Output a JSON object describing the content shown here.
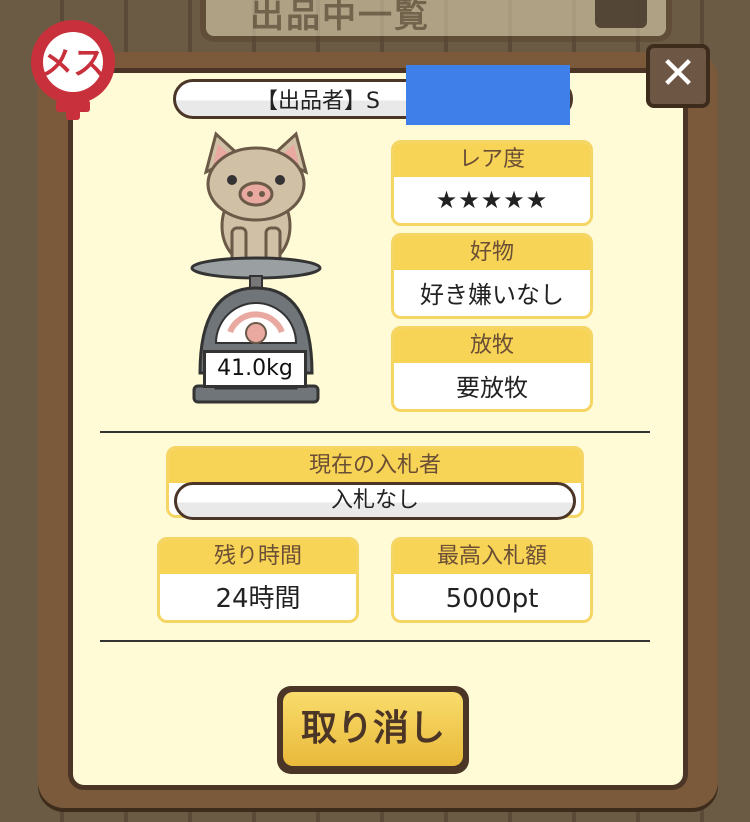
{
  "background": {
    "title": "出品中一覧"
  },
  "dialog": {
    "gender_badge": "メス",
    "close_glyph": "✕",
    "seller_label": "【出品者】S",
    "weight": "41.0kg",
    "rarity": {
      "label": "レア度",
      "stars": "★★★★★",
      "value": 5,
      "max": 5
    },
    "favorite": {
      "label": "好物",
      "value": "好き嫌いなし"
    },
    "grazing": {
      "label": "放牧",
      "value": "要放牧"
    },
    "current_bidder": {
      "label": "現在の入札者",
      "value": "入札なし"
    },
    "time_left": {
      "label": "残り時間",
      "value": "24時間"
    },
    "highest_bid": {
      "label": "最高入札額",
      "value": "5000pt"
    },
    "cancel_label": "取り消し"
  },
  "colors": {
    "card_header": "#f7d455",
    "dialog_bg": "#fffbd6",
    "frame": "#4a3526",
    "star": "#e7958c",
    "redaction": "#3f7fea"
  }
}
